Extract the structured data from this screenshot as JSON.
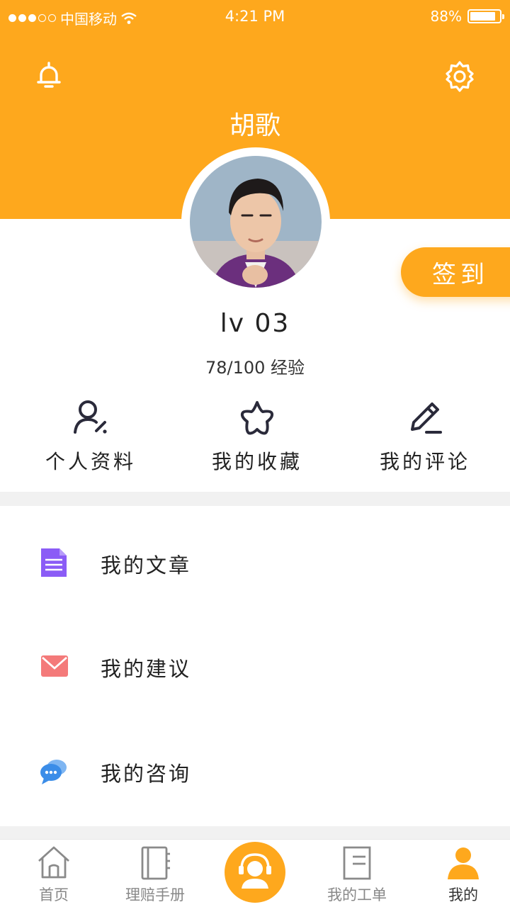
{
  "status_bar": {
    "carrier": "中国移动",
    "time": "4:21 PM",
    "battery": "88%",
    "battery_level": 0.88,
    "signal_dots_filled": 3,
    "signal_dots_total": 5
  },
  "header": {
    "username": "胡歌",
    "left_icon": "bell-icon",
    "right_icon": "gear-icon",
    "bg_color": "#FEA81D"
  },
  "profile": {
    "level": "lv 03",
    "experience": "78/100 经验",
    "experience_progress": 0.78,
    "signin_label": "签到"
  },
  "quick_actions": [
    {
      "label": "个人资料",
      "icon": "user-edit-icon"
    },
    {
      "label": "我的收藏",
      "icon": "star-icon"
    },
    {
      "label": "我的评论",
      "icon": "pencil-icon"
    }
  ],
  "menu": [
    {
      "label": "我的文章",
      "icon": "document-icon",
      "color": "#8B5CF6"
    },
    {
      "label": "我的建议",
      "icon": "mail-icon",
      "color": "#F47A7A"
    },
    {
      "label": "我的咨询",
      "icon": "chat-icon",
      "color": "#3B8DE8"
    }
  ],
  "tabbar": {
    "tabs": [
      {
        "label": "首页",
        "icon": "home-icon"
      },
      {
        "label": "理赔手册",
        "icon": "notebook-icon"
      },
      {
        "label": "",
        "icon": "headset-service-icon"
      },
      {
        "label": "我的工单",
        "icon": "order-icon"
      },
      {
        "label": "我的",
        "icon": "person-icon"
      }
    ],
    "active_index": 4,
    "accent_color": "#FEA81D"
  }
}
